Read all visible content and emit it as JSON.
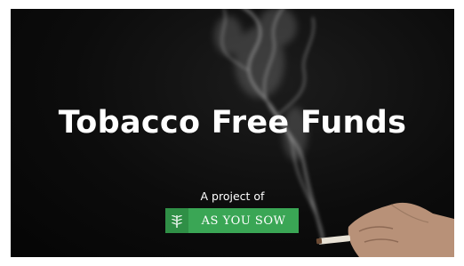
{
  "title": "Tobacco Free Funds",
  "subtitle": "A project of",
  "logo": {
    "text": "AS YOU SOW",
    "icon": "sprout-icon",
    "color": "#3aa655"
  },
  "background_color": "#0c0c0c"
}
